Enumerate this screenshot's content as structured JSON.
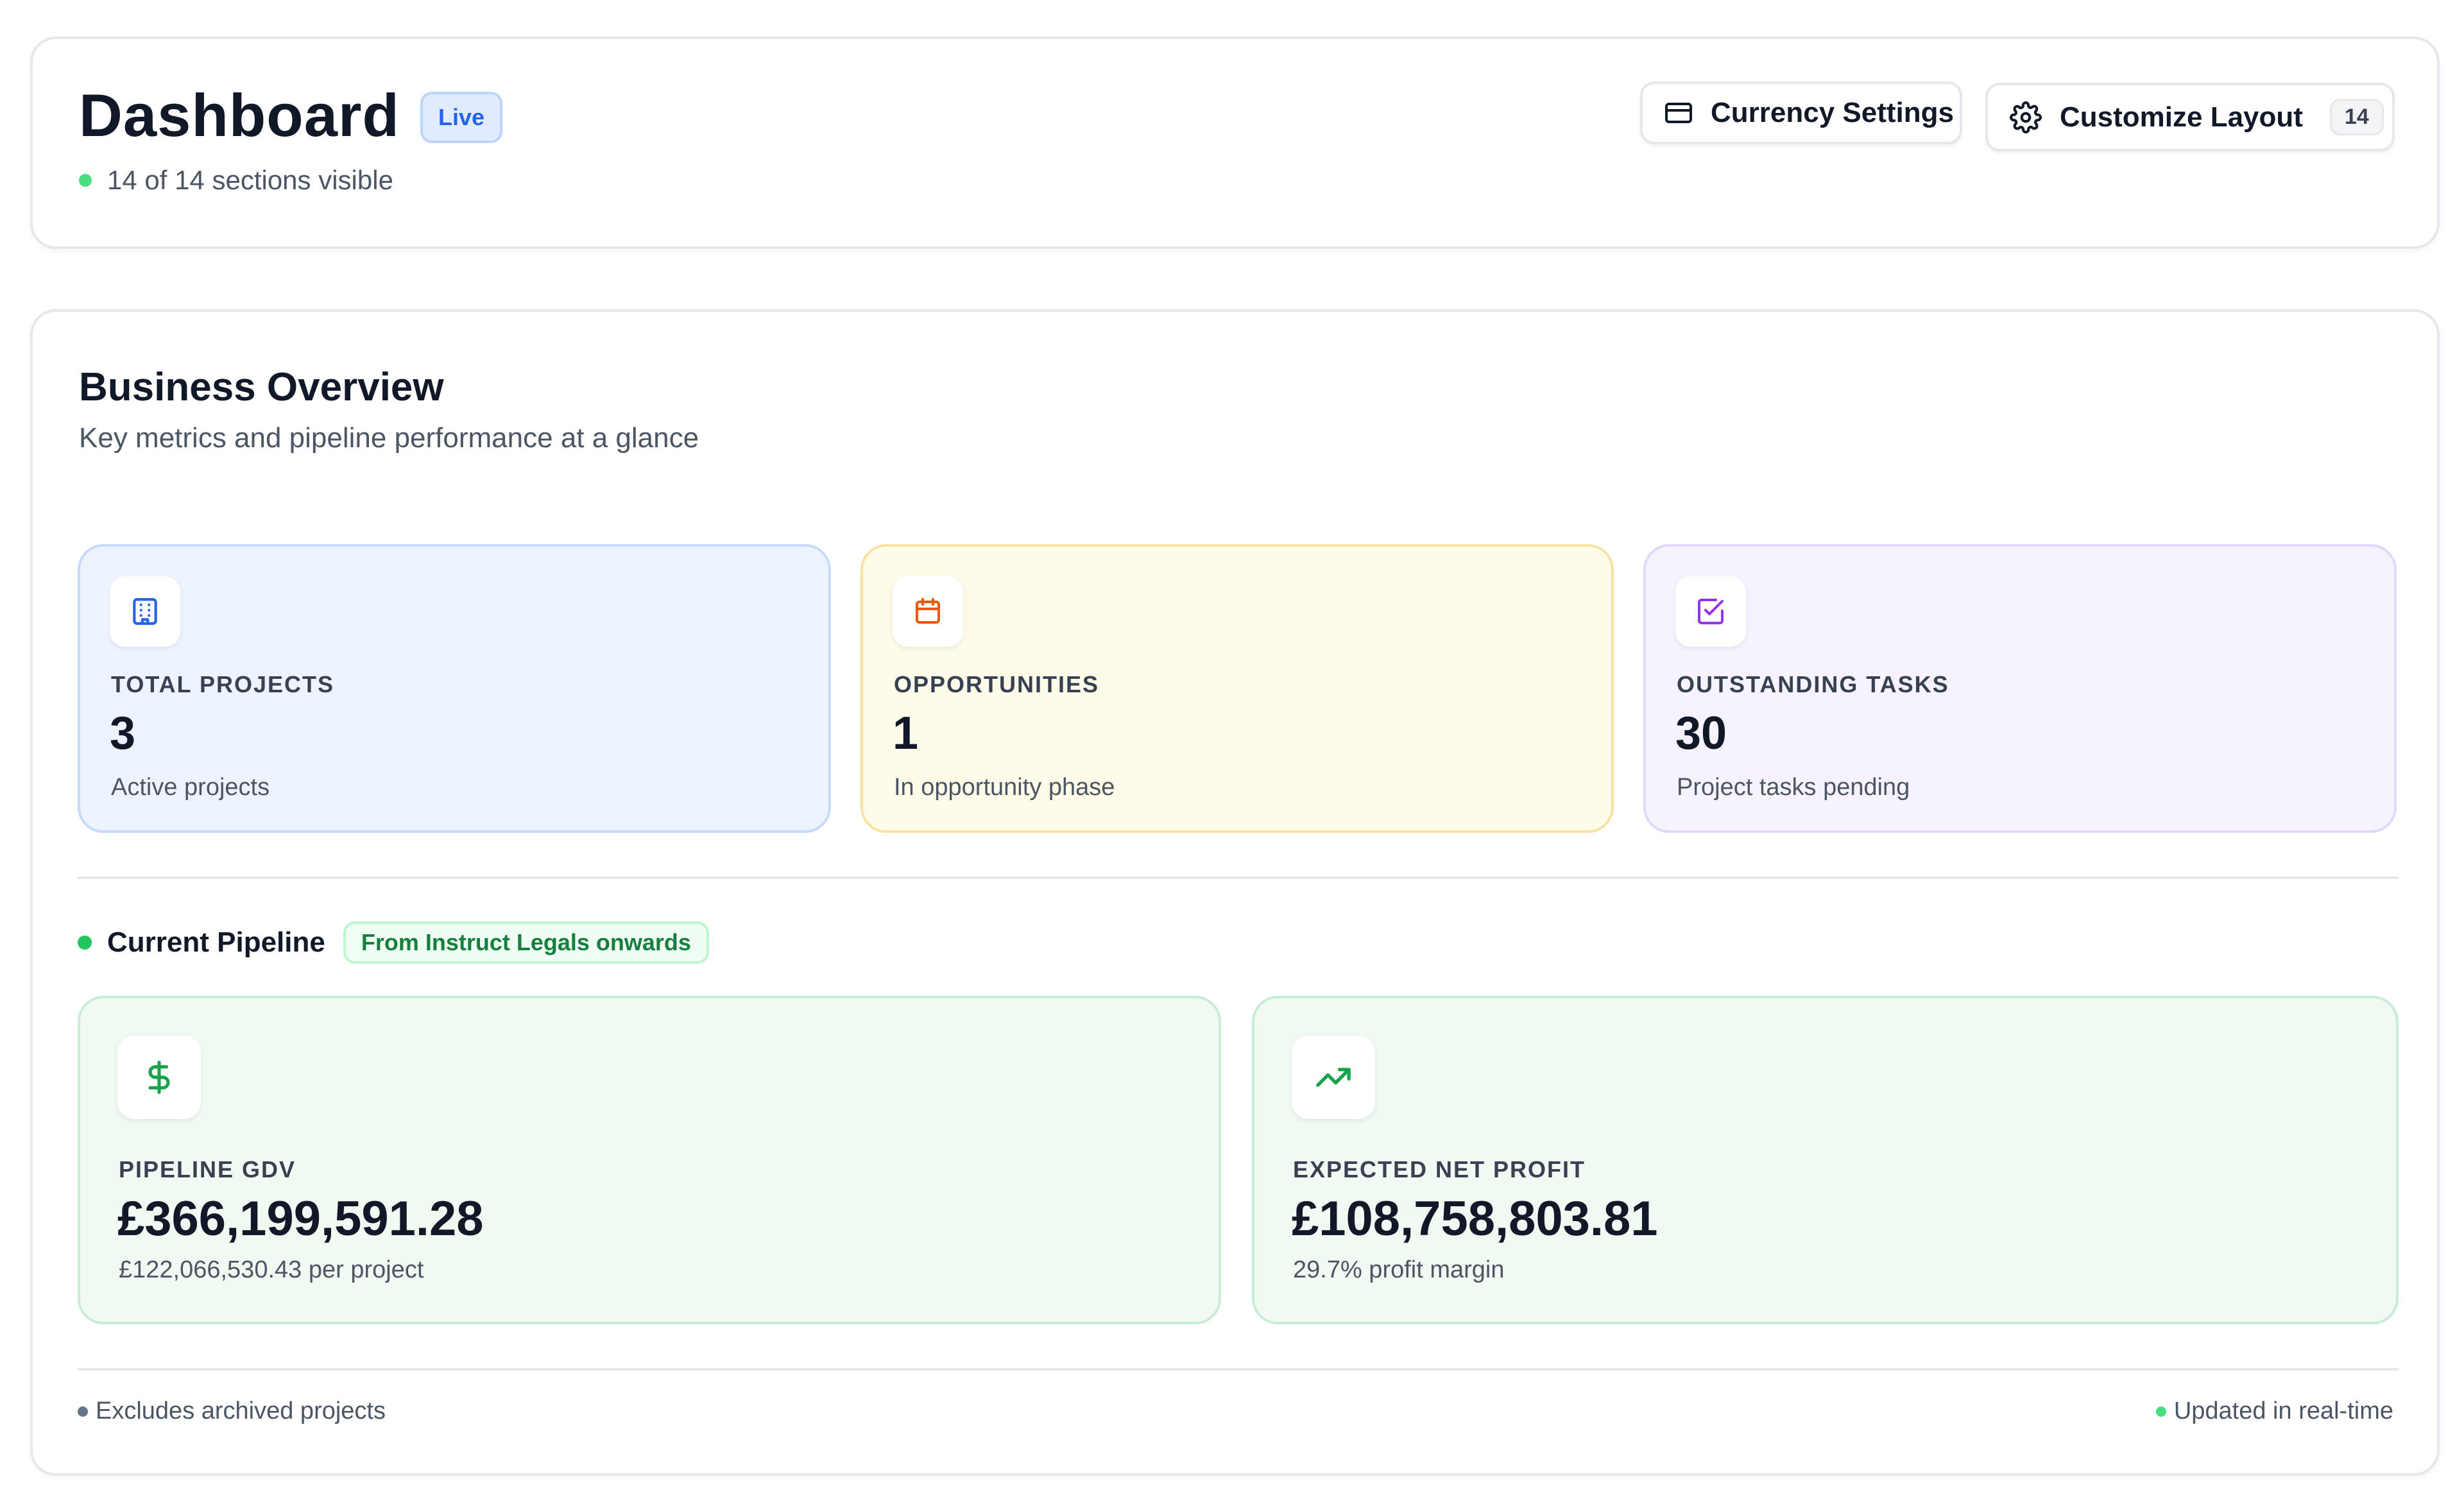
{
  "header": {
    "title": "Dashboard",
    "live_badge": "Live",
    "sections_visible": "14 of 14 sections visible",
    "currency_settings_label": "Currency Settings",
    "customize_layout_label": "Customize Layout",
    "customize_layout_count": "14"
  },
  "overview": {
    "title": "Business Overview",
    "subtitle": "Key metrics and pipeline performance at a glance",
    "metrics": [
      {
        "label": "TOTAL PROJECTS",
        "value": "3",
        "sub": "Active projects",
        "icon": "building-icon",
        "accent": "#2563eb"
      },
      {
        "label": "OPPORTUNITIES",
        "value": "1",
        "sub": "In opportunity phase",
        "icon": "calendar-icon",
        "accent": "#ea580c"
      },
      {
        "label": "OUTSTANDING TASKS",
        "value": "30",
        "sub": "Project tasks pending",
        "icon": "check-square-icon",
        "accent": "#9333ea"
      }
    ],
    "pipeline": {
      "title": "Current Pipeline",
      "badge": "From Instruct Legals onwards",
      "cards": [
        {
          "label": "PIPELINE GDV",
          "value": "£366,199,591.28",
          "sub": "£122,066,530.43 per project",
          "icon": "dollar-icon"
        },
        {
          "label": "EXPECTED NET PROFIT",
          "value": "£108,758,803.81",
          "sub": "29.7% profit margin",
          "icon": "trending-up-icon"
        }
      ]
    },
    "footer": {
      "left": "Excludes archived projects",
      "right": "Updated in real-time"
    }
  },
  "colors": {
    "live_blue": "#2563eb",
    "pipeline_green": "#16a34a",
    "status_green": "#4ade80"
  }
}
